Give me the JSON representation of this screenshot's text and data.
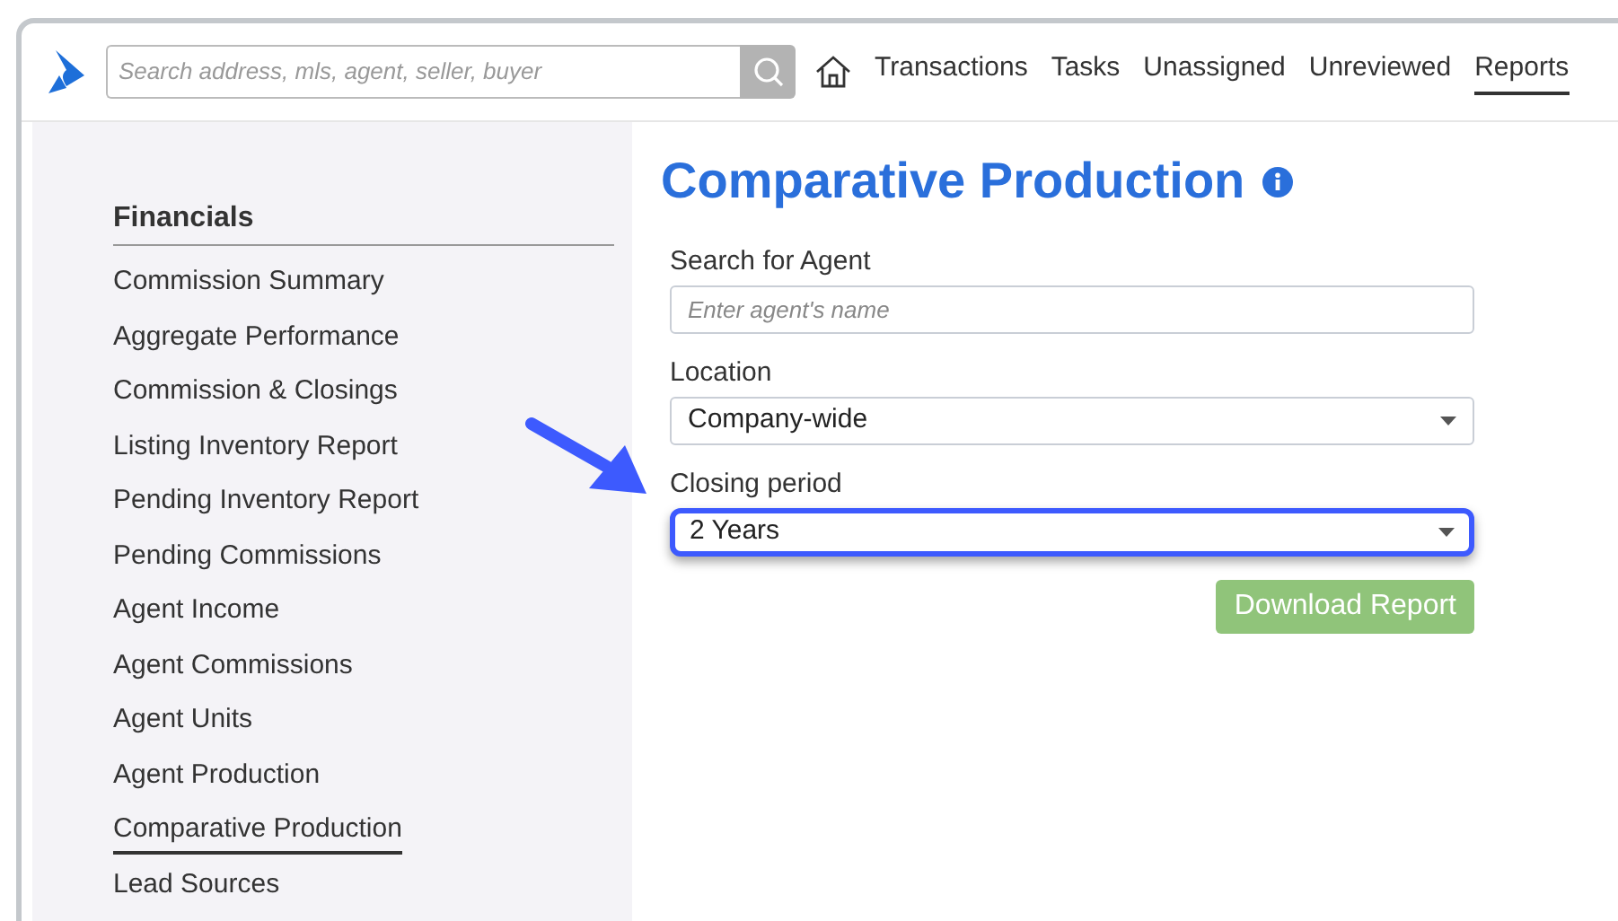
{
  "header": {
    "search": {
      "placeholder": "Search address, mls, agent, seller, buyer"
    },
    "nav": [
      {
        "label": "Transactions",
        "selected": false
      },
      {
        "label": "Tasks",
        "selected": false
      },
      {
        "label": "Unassigned",
        "selected": false
      },
      {
        "label": "Unreviewed",
        "selected": false
      },
      {
        "label": "Reports",
        "selected": true
      }
    ]
  },
  "sidebar": {
    "heading": "Financials",
    "items": [
      {
        "label": "Commission Summary",
        "selected": false
      },
      {
        "label": "Aggregate Performance",
        "selected": false
      },
      {
        "label": "Commission & Closings",
        "selected": false
      },
      {
        "label": "Listing Inventory Report",
        "selected": false
      },
      {
        "label": "Pending Inventory Report",
        "selected": false
      },
      {
        "label": "Pending Commissions",
        "selected": false
      },
      {
        "label": "Agent Income",
        "selected": false
      },
      {
        "label": "Agent Commissions",
        "selected": false
      },
      {
        "label": "Agent Units",
        "selected": false
      },
      {
        "label": "Agent Production",
        "selected": false
      },
      {
        "label": "Comparative Production",
        "selected": true
      },
      {
        "label": "Lead Sources",
        "selected": false
      }
    ]
  },
  "main": {
    "title": "Comparative Production",
    "fields": [
      {
        "kind": "text",
        "label": "Search for Agent",
        "placeholder": "Enter agent's name",
        "highlighted": false
      },
      {
        "kind": "select",
        "label": "Location",
        "value": "Company-wide",
        "highlighted": false
      },
      {
        "kind": "select",
        "label": "Closing period",
        "value": "2 Years",
        "highlighted": true
      }
    ],
    "button": "Download Report"
  }
}
